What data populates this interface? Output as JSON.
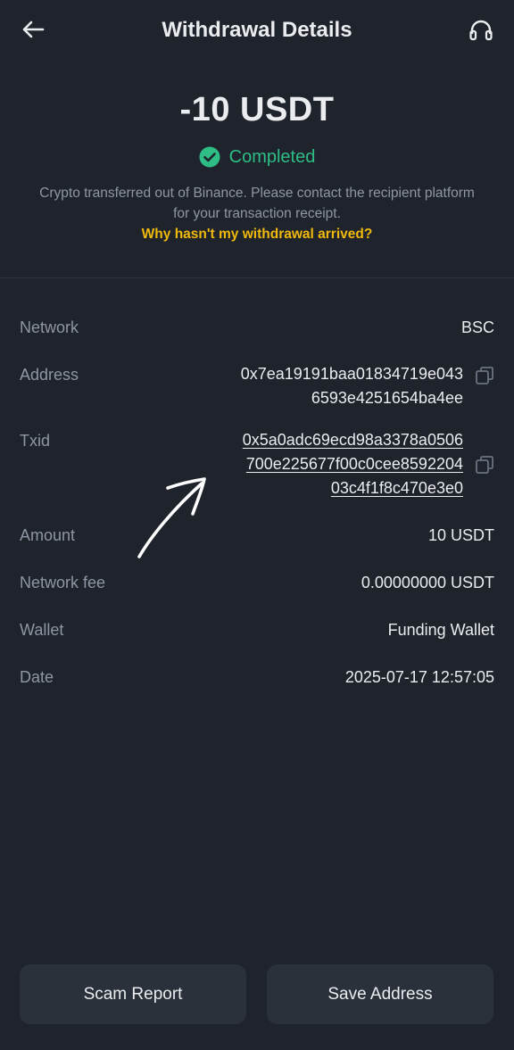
{
  "header": {
    "title": "Withdrawal Details"
  },
  "summary": {
    "amount": "-10 USDT",
    "status": "Completed",
    "description": "Crypto transferred out of Binance. Please contact the recipient platform for your transaction receipt.",
    "help_link": "Why hasn't my withdrawal arrived?"
  },
  "details": {
    "network": {
      "label": "Network",
      "value": "BSC"
    },
    "address": {
      "label": "Address",
      "line1": "0x7ea19191baa01834719e043",
      "line2": "6593e4251654ba4ee"
    },
    "txid": {
      "label": "Txid",
      "line1": "0x5a0adc69ecd98a3378a0506",
      "line2": "700e225677f00c0cee8592204",
      "line3": "03c4f1f8c470e3e0"
    },
    "amount": {
      "label": "Amount",
      "value": "10 USDT"
    },
    "network_fee": {
      "label": "Network fee",
      "value": "0.00000000 USDT"
    },
    "wallet": {
      "label": "Wallet",
      "value": "Funding Wallet"
    },
    "date": {
      "label": "Date",
      "value": "2025-07-17 12:57:05"
    }
  },
  "buttons": {
    "scam_report": "Scam Report",
    "save_address": "Save Address"
  },
  "colors": {
    "background": "#1f242c",
    "success": "#2ebd85",
    "link": "#f0b90b",
    "muted_text": "#8f96a3",
    "button_bg": "#2b313a"
  },
  "icons": {
    "back": "arrow-left-icon",
    "support": "headset-icon",
    "status": "check-circle-icon",
    "copy": "copy-icon",
    "annotation": "hand-drawn-arrow"
  }
}
